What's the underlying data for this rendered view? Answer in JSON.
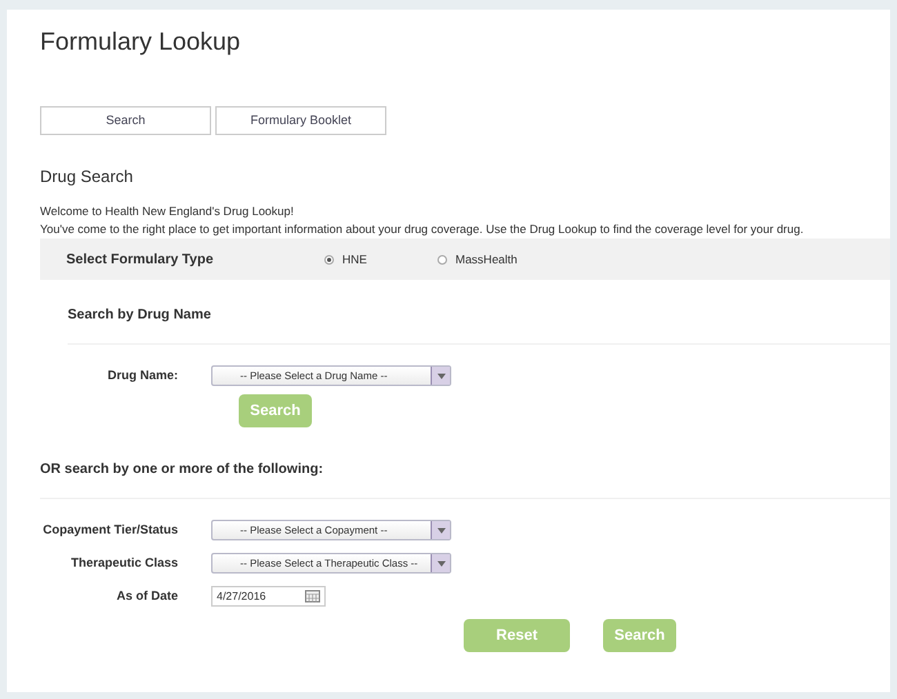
{
  "title": "Formulary Lookup",
  "tabs": [
    {
      "label": "Search"
    },
    {
      "label": "Formulary Booklet"
    }
  ],
  "section_title": "Drug Search",
  "intro": [
    "Welcome to Health New England's Drug Lookup!",
    "You've come to the right place to get important information about your drug coverage. Use the Drug Lookup to find the coverage level for your drug."
  ],
  "formulary_type": {
    "label": "Select Formulary Type",
    "options": [
      {
        "label": "HNE",
        "selected": true
      },
      {
        "label": "MassHealth",
        "selected": false
      }
    ]
  },
  "by_name": {
    "heading": "Search by Drug Name",
    "field": {
      "label": "Drug Name:",
      "placeholder": "-- Please Select a Drug Name --"
    },
    "button": "Search"
  },
  "by_criteria": {
    "heading": "OR search by one or more of the following:",
    "fields": [
      {
        "kind": "select",
        "label": "Copayment Tier/Status",
        "placeholder": "-- Please Select a Copayment --"
      },
      {
        "kind": "select",
        "label": "Therapeutic Class",
        "placeholder": "-- Please Select a Therapeutic Class --"
      },
      {
        "kind": "date",
        "label": "As of Date",
        "value": "4/27/2016"
      }
    ],
    "buttons": [
      "Reset",
      "Search"
    ]
  }
}
